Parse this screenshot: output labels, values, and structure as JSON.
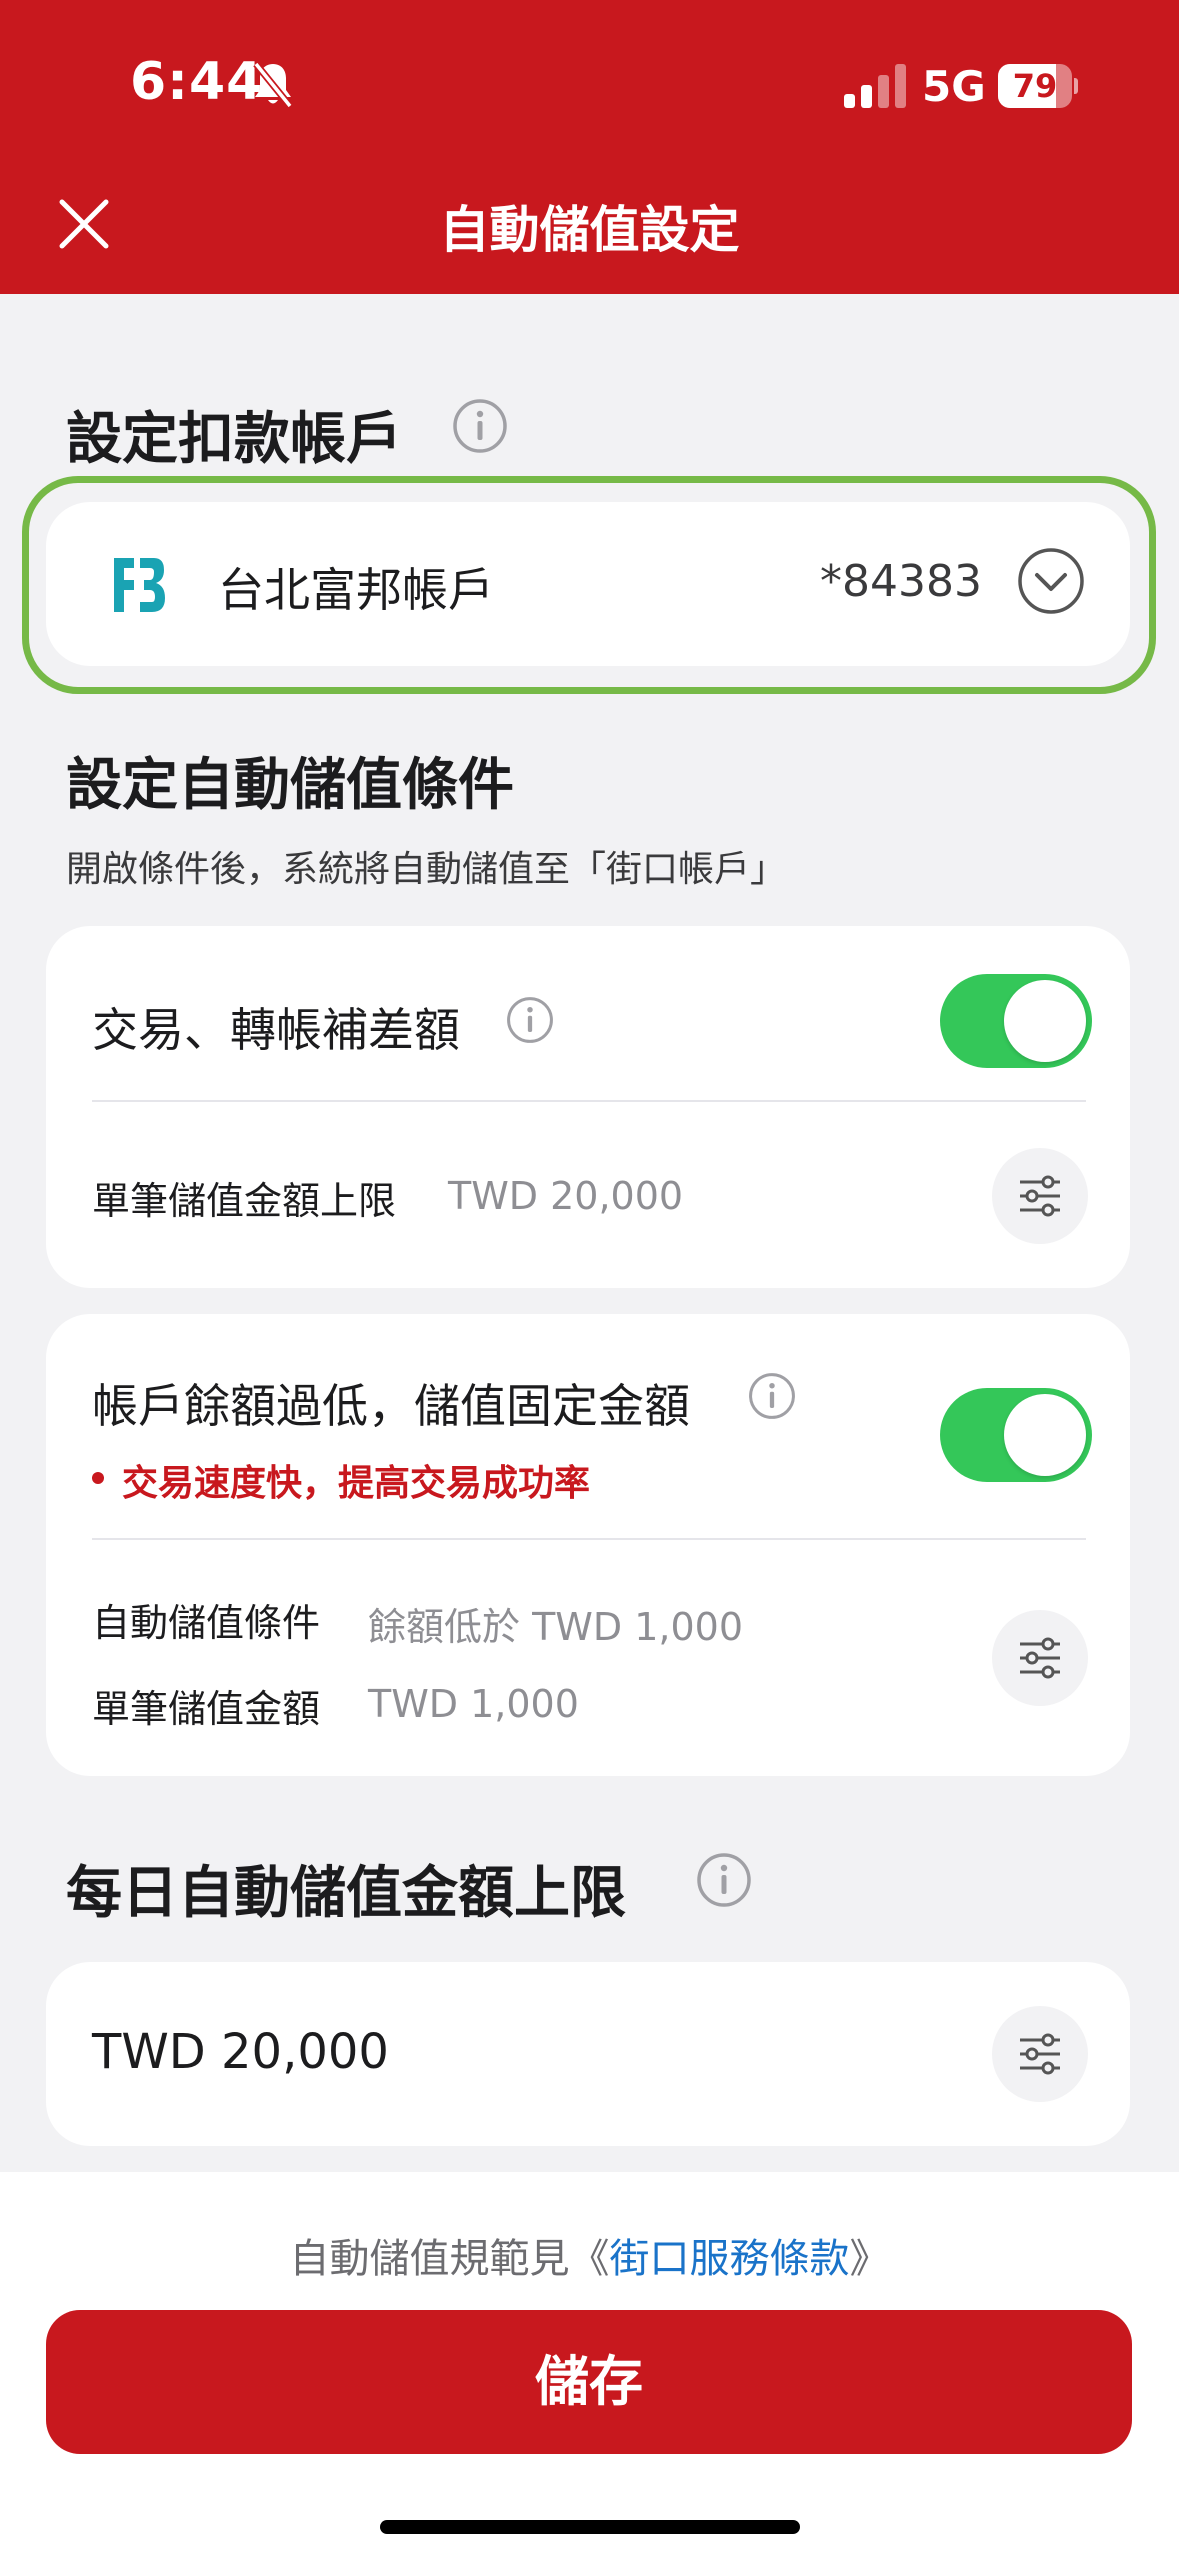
{
  "status_bar": {
    "time": "6:44",
    "network": "5G",
    "battery": "79",
    "battery_level": 0.79
  },
  "header": {
    "title": "自動儲值設定"
  },
  "account_section": {
    "title": "設定扣款帳戶",
    "bank_name": "台北富邦帳戶",
    "account_number": "*84383"
  },
  "conditions_section": {
    "title": "設定自動儲值條件",
    "subtitle": "開啟條件後，系統將自動儲值至「街口帳戶」",
    "option1": {
      "title": "交易、轉帳補差額",
      "enabled": true,
      "limit_label": "單筆儲值金額上限",
      "limit_value": "TWD 20,000"
    },
    "option2": {
      "title": "帳戶餘額過低，儲值固定金額",
      "enabled": true,
      "note": "交易速度快，提高交易成功率",
      "condition_label": "自動儲值條件",
      "condition_value": "餘額低於 TWD 1,000",
      "amount_label": "單筆儲值金額",
      "amount_value": "TWD 1,000"
    }
  },
  "daily_limit_section": {
    "title": "每日自動儲值金額上限",
    "value": "TWD 20,000"
  },
  "footer": {
    "terms_prefix": "自動儲值規範見《",
    "terms_link": "街口服務條款",
    "terms_suffix": "》",
    "save_label": "儲存"
  },
  "colors": {
    "brand_red": "#c8181e",
    "toggle_on": "#34c759",
    "highlight_green": "#76b947",
    "link_blue": "#1a73c9"
  }
}
